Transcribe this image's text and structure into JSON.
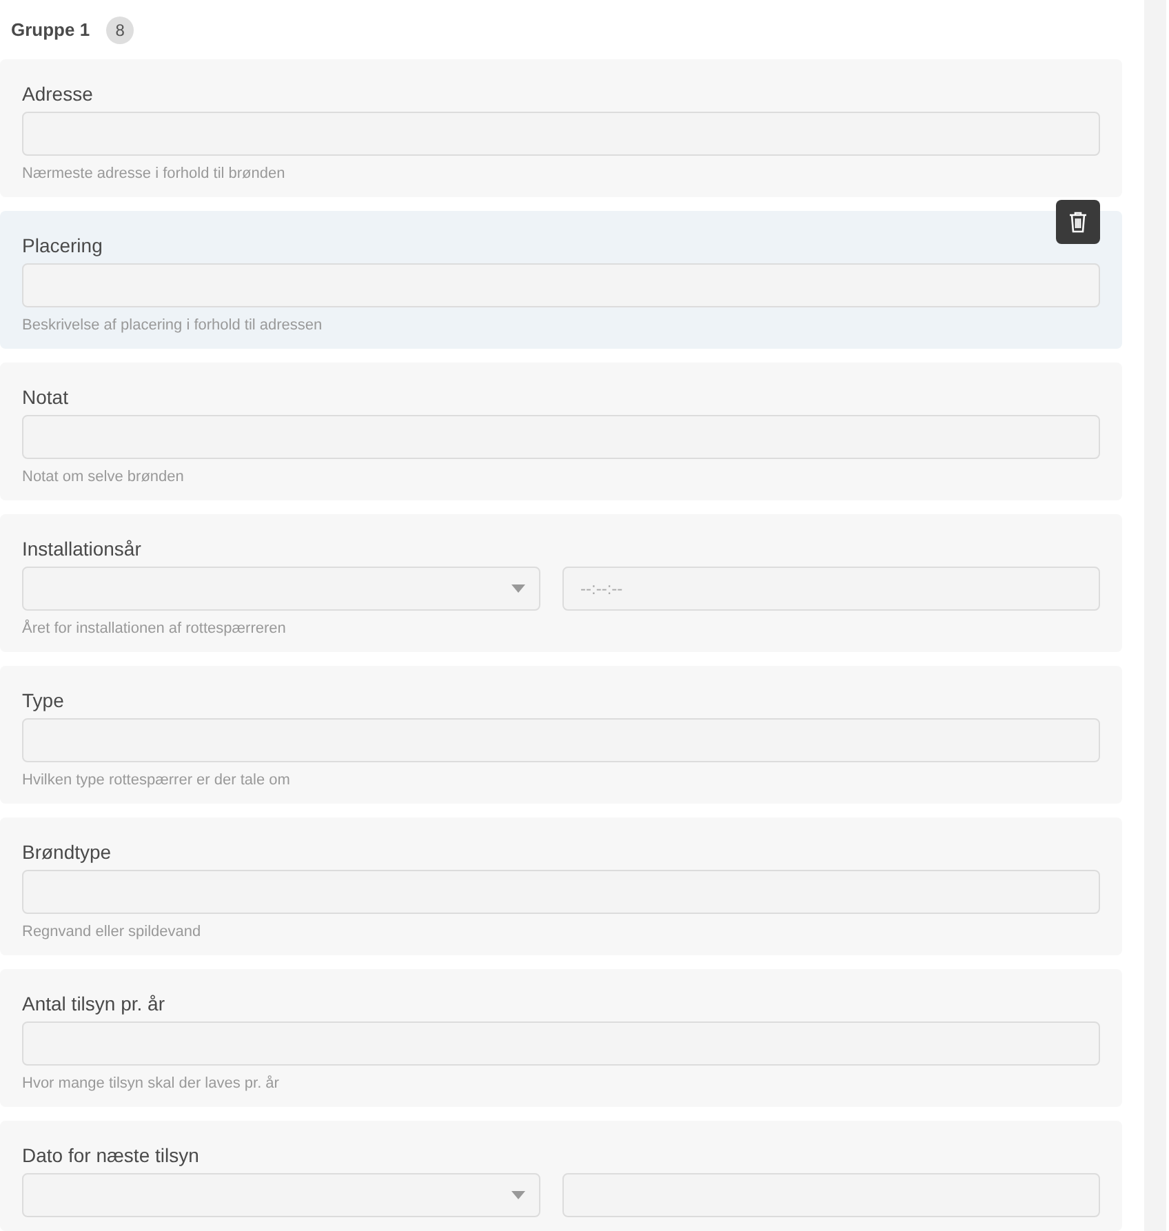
{
  "group": {
    "title": "Gruppe 1",
    "count": "8"
  },
  "fields": [
    {
      "kind": "text",
      "label": "Adresse",
      "hint": "Nærmeste adresse i forhold til brønden",
      "selected": false
    },
    {
      "kind": "text",
      "label": "Placering",
      "hint": "Beskrivelse af placering i forhold til adressen",
      "selected": true
    },
    {
      "kind": "text",
      "label": "Notat",
      "hint": "Notat om selve brønden",
      "selected": false
    },
    {
      "kind": "datetime",
      "label": "Installationsår",
      "time_placeholder": "--:--:--",
      "hint": "Året for installationen af rottespærreren",
      "selected": false
    },
    {
      "kind": "text",
      "label": "Type",
      "hint": "Hvilken type rottespærrer er der tale om",
      "selected": false
    },
    {
      "kind": "text",
      "label": "Brøndtype",
      "hint": "Regnvand eller spildevand",
      "selected": false
    },
    {
      "kind": "text",
      "label": "Antal tilsyn pr. år",
      "hint": "Hvor mange tilsyn skal der laves pr. år",
      "selected": false
    },
    {
      "kind": "datetime",
      "label": "Dato for næste tilsyn",
      "selected": false
    }
  ]
}
